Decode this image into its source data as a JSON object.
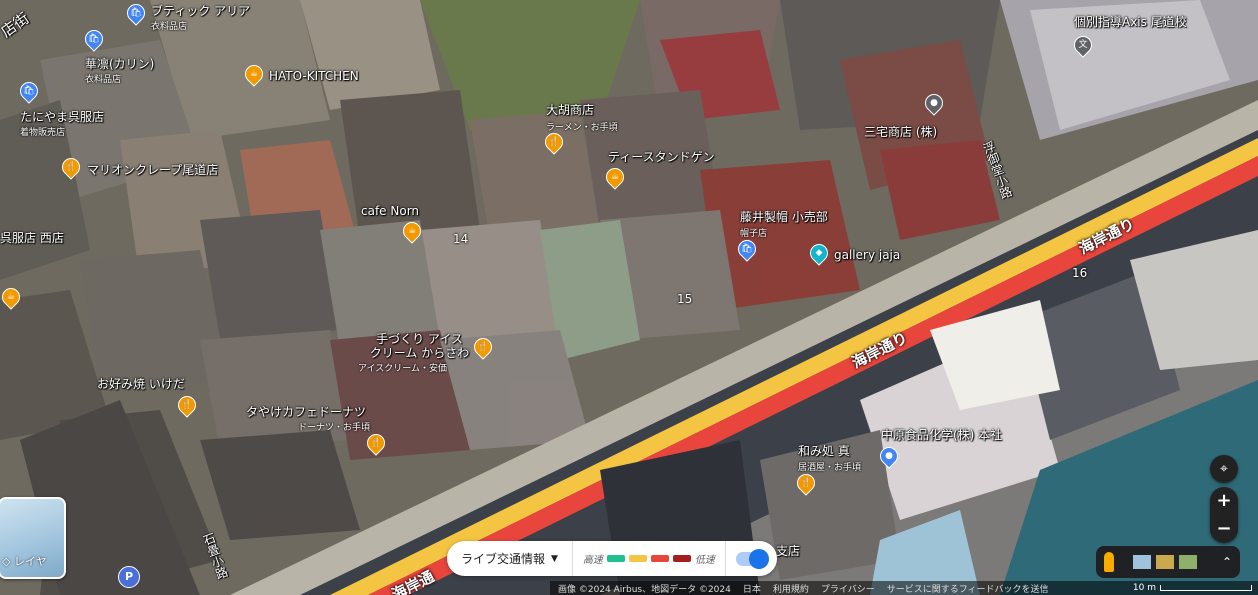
{
  "map": {
    "roads": [
      {
        "name": "海岸通り"
      },
      {
        "name": "海岸通"
      },
      {
        "name": "浮御堂小路"
      },
      {
        "name": "石畳小路"
      },
      {
        "name": "店街"
      }
    ],
    "block_numbers": [
      "14",
      "15",
      "16"
    ],
    "places": [
      {
        "name": "ブティック アリア",
        "sub": "衣料品店",
        "icon": "shopping-bag-icon"
      },
      {
        "name": "華凛(カリン)",
        "sub": "衣料品店",
        "icon": "shopping-bag-icon"
      },
      {
        "name": "たにやま呉服店",
        "sub": "着物販売店",
        "icon": "shopping-bag-icon"
      },
      {
        "name": "HATO-KITCHEN",
        "sub": "",
        "icon": "cafe-icon"
      },
      {
        "name": "大胡商店",
        "sub": "ラーメン・お手頃",
        "icon": "restaurant-icon"
      },
      {
        "name": "ティースタンドゲン",
        "sub": "",
        "icon": "cafe-icon"
      },
      {
        "name": "マリオンクレープ尾道店",
        "sub": "",
        "icon": "restaurant-icon"
      },
      {
        "name": "三宅商店 (株)",
        "sub": "",
        "icon": "place-pin-icon"
      },
      {
        "name": "個別指導Axis 尾道校",
        "sub": "",
        "icon": "school-icon"
      },
      {
        "name": "cafe Norn",
        "sub": "",
        "icon": "cafe-icon"
      },
      {
        "name": "藤井製帽 小売部",
        "sub": "帽子店",
        "icon": "shopping-bag-icon"
      },
      {
        "name": "gallery jaja",
        "sub": "",
        "icon": "gallery-icon"
      },
      {
        "name": "呉服店 西店",
        "sub": "",
        "icon": ""
      },
      {
        "name": "手づくり アイス\nクリーム からさわ",
        "sub": "アイスクリーム・安価",
        "icon": "restaurant-icon"
      },
      {
        "name": "お好み焼 いけだ",
        "sub": "",
        "icon": "restaurant-icon"
      },
      {
        "name": "タやけカフェドーナツ",
        "sub": "ドーナツ・お手頃",
        "icon": "restaurant-icon"
      },
      {
        "name": "和み処 真",
        "sub": "居酒屋・お手頃",
        "icon": "restaurant-icon"
      },
      {
        "name": "中原食品化学(株) 本社",
        "sub": "",
        "icon": "place-pin-icon"
      },
      {
        "name": "支店",
        "sub": "",
        "icon": ""
      }
    ]
  },
  "controls": {
    "layers_label": "レイヤ",
    "traffic_label": "ライブ交通情報",
    "legend_fast": "高速",
    "legend_slow": "低速",
    "legend_colors": [
      "#1fbf8f",
      "#f4c542",
      "#e8453c",
      "#a51d1d"
    ],
    "zoom_in": "+",
    "zoom_out": "−"
  },
  "footer": {
    "imagery": "画像 ©2024 Airbus、地図データ ©2024",
    "region": "日本",
    "terms": "利用規約",
    "privacy": "プライバシー",
    "feedback": "サービスに関するフィードバックを送信",
    "scale": "10 m"
  }
}
